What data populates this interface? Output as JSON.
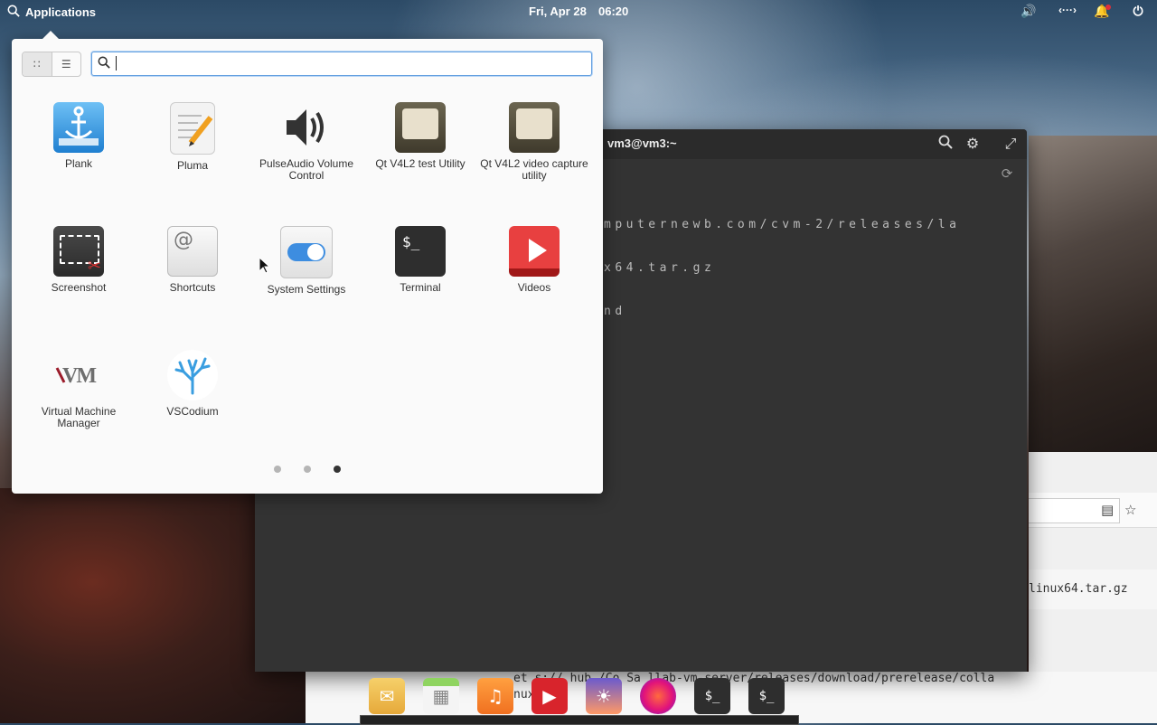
{
  "panel": {
    "applications_label": "Applications",
    "date": "Fri, Apr 28",
    "time": "06:20"
  },
  "terminal": {
    "title": "vm3@vm3:~",
    "output_lines": [
      "mputernewb.com/cvm-2/releases/la",
      "x64.tar.gz",
      "nd"
    ]
  },
  "browser": {
    "row_text": "linux64.tar.gz",
    "wget_line1": "et  s://  hub  /Co   Sa   llab-vm-server/releases/download/prerelease/colla",
    "wget_line2": "nux  ar."
  },
  "launcher": {
    "search_placeholder": "",
    "apps": [
      {
        "name": "Plank"
      },
      {
        "name": "Pluma"
      },
      {
        "name": "PulseAudio Volume Control"
      },
      {
        "name": "Qt V4L2 test Utility"
      },
      {
        "name": "Qt V4L2 video capture utility"
      },
      {
        "name": "Screenshot"
      },
      {
        "name": "Shortcuts"
      },
      {
        "name": "System Settings"
      },
      {
        "name": "Terminal"
      },
      {
        "name": "Videos"
      },
      {
        "name": "Virtual Machine Manager"
      },
      {
        "name": "VSCodium"
      }
    ],
    "pages": 3,
    "active_page": 3
  },
  "dock": {
    "items": [
      "mail-icon",
      "calendar-icon",
      "music-icon",
      "videos-icon",
      "photos-icon",
      "firefox-icon",
      "terminal-icon",
      "terminal-icon"
    ]
  },
  "colors": {
    "accent": "#64a0e0",
    "terminal_bg": "#333333",
    "panel_text": "#ffffff"
  }
}
